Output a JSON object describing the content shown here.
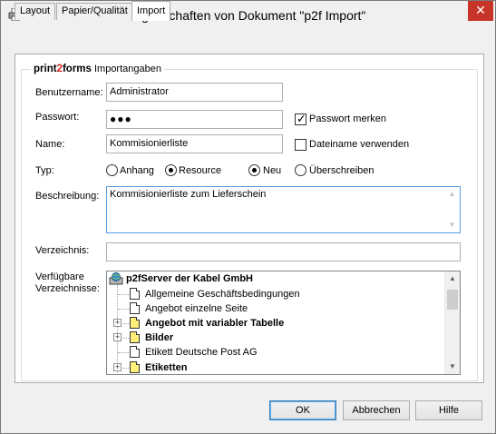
{
  "window": {
    "title": "Eigenschaften von Dokument \"p2f Import\"",
    "close_label": "✕"
  },
  "tabs": [
    {
      "label": "Layout",
      "active": false
    },
    {
      "label": "Papier/Qualität",
      "active": false
    },
    {
      "label": "Import",
      "active": true
    }
  ],
  "group": {
    "brand_prefix": "print",
    "brand_two": "2",
    "brand_suffix": "forms",
    "legend": " Importangaben"
  },
  "form": {
    "benutzername_label": "Benutzername:",
    "benutzername_value": "Administrator",
    "passwort_label": "Passwort:",
    "passwort_value": "●●●",
    "passwort_merken_label": "Passwort merken",
    "passwort_merken_checked": true,
    "name_label": "Name:",
    "name_value": "Kommisionierliste",
    "dateiname_label": "Dateiname verwenden",
    "dateiname_checked": false,
    "typ_label": "Typ:",
    "typ_options": [
      {
        "label": "Anhang",
        "selected": false
      },
      {
        "label": "Resource",
        "selected": true
      }
    ],
    "mode_options": [
      {
        "label": "Neu",
        "selected": true
      },
      {
        "label": "Überschreiben",
        "selected": false
      }
    ],
    "beschreibung_label": "Beschreibung:",
    "beschreibung_value": "Kommisionierliste zum Lieferschein",
    "verzeichnis_label": "Verzeichnis:",
    "verzeichnis_value": "",
    "verfuegbare_label_1": "Verfügbare",
    "verfuegbare_label_2": "Verzeichnisse:"
  },
  "tree": {
    "root": "p2fServer der Kabel GmbH",
    "items": [
      {
        "label": "Allgemeine Geschäftsbedingungen",
        "bold": false,
        "expandable": false,
        "icon": "document-icon"
      },
      {
        "label": "Angebot einzelne Seite",
        "bold": false,
        "expandable": false,
        "icon": "document-icon"
      },
      {
        "label": "Angebot mit variabler Tabelle",
        "bold": true,
        "expandable": true,
        "icon": "document-stack-icon"
      },
      {
        "label": "Bilder",
        "bold": true,
        "expandable": true,
        "icon": "document-stack-icon"
      },
      {
        "label": "Etikett Deutsche Post AG",
        "bold": false,
        "expandable": false,
        "icon": "document-icon"
      },
      {
        "label": "Etiketten",
        "bold": true,
        "expandable": true,
        "icon": "document-stack-icon"
      }
    ]
  },
  "buttons": {
    "ok": "OK",
    "cancel": "Abbrechen",
    "help": "Hilfe"
  },
  "colors": {
    "accent": "#569de5",
    "close": "#c7342a",
    "brand_two": "#d0281f",
    "folder_yellow": "#ffee7a"
  }
}
